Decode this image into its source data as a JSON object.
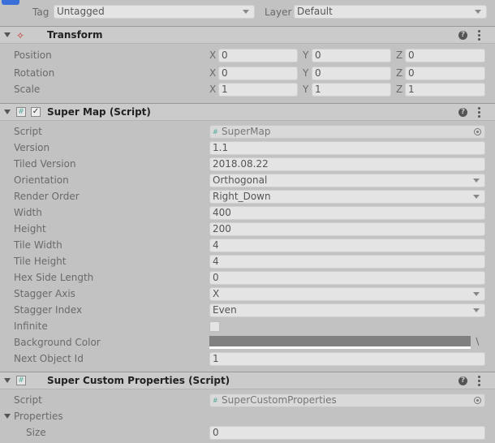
{
  "top": {
    "tag_label": "Tag",
    "tag_value": "Untagged",
    "layer_label": "Layer",
    "layer_value": "Default"
  },
  "transform": {
    "title": "Transform",
    "rows": [
      {
        "label": "Position",
        "x": "0",
        "y": "0",
        "z": "0"
      },
      {
        "label": "Rotation",
        "x": "0",
        "y": "0",
        "z": "0"
      },
      {
        "label": "Scale",
        "x": "1",
        "y": "1",
        "z": "1"
      }
    ],
    "axis_x": "X",
    "axis_y": "Y",
    "axis_z": "Z"
  },
  "supermap": {
    "title": "Super Map (Script)",
    "script_label": "Script",
    "script_value": "SuperMap",
    "fields": [
      {
        "label": "Version",
        "value": "1.1"
      },
      {
        "label": "Tiled Version",
        "value": "2018.08.22"
      },
      {
        "label": "Orientation",
        "value": "Orthogonal"
      },
      {
        "label": "Render Order",
        "value": "Right_Down"
      },
      {
        "label": "Width",
        "value": "400"
      },
      {
        "label": "Height",
        "value": "200"
      },
      {
        "label": "Tile Width",
        "value": "4"
      },
      {
        "label": "Tile Height",
        "value": "4"
      },
      {
        "label": "Hex Side Length",
        "value": "0"
      },
      {
        "label": "Stagger Axis",
        "value": "X"
      },
      {
        "label": "Stagger Index",
        "value": "Even"
      },
      {
        "label": "Infinite",
        "value": ""
      },
      {
        "label": "Background Color",
        "value": ""
      },
      {
        "label": "Next Object Id",
        "value": "1"
      }
    ],
    "background_color": "#808080"
  },
  "customprops": {
    "title": "Super Custom Properties (Script)",
    "script_label": "Script",
    "script_value": "SuperCustomProperties",
    "properties_label": "Properties",
    "size_label": "Size",
    "size_value": "0"
  }
}
